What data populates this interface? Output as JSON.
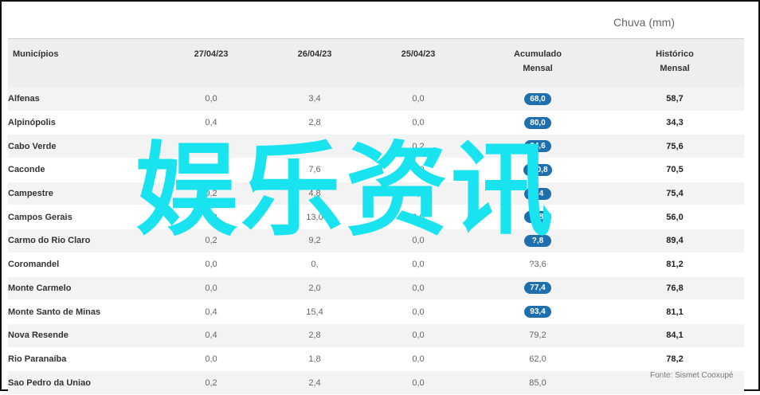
{
  "header": {
    "unit_label": "Chuva (mm)"
  },
  "columns": [
    "Municípios",
    "27/04/23",
    "26/04/23",
    "25/04/23",
    "Acumulado\nMensal",
    "Histórico\nMensal"
  ],
  "rows": [
    {
      "municipio": "Alfenas",
      "d27": "0,0",
      "d26": "3,4",
      "d25": "0,0",
      "acumulado": "68,0",
      "highlight": true,
      "historico": "58,7"
    },
    {
      "municipio": "Alpinópolis",
      "d27": "0,4",
      "d26": "2,8",
      "d25": "0,0",
      "acumulado": "80,0",
      "highlight": true,
      "historico": "34,3"
    },
    {
      "municipio": "Cabo Verde",
      "d27": "0,2",
      "d26": "11,4",
      "d25": "0,2",
      "acumulado": "94,6",
      "highlight": true,
      "historico": "75,6"
    },
    {
      "municipio": "Caconde",
      "d27": "0,2",
      "d26": "7,6",
      "d25": "0,0",
      "acumulado": "140,8",
      "highlight": true,
      "historico": "70,5"
    },
    {
      "municipio": "Campestre",
      "d27": "0,2",
      "d26": "4,8",
      "d25": "0,0",
      "acumulado": "?,4",
      "highlight": true,
      "historico": "75,4"
    },
    {
      "municipio": "Campos Gerais",
      "d27": "0,0",
      "d26": "13,0",
      "d25": "0,0",
      "acumulado": "?,8",
      "highlight": true,
      "historico": "56,0"
    },
    {
      "municipio": "Carmo do Rio Claro",
      "d27": "0,2",
      "d26": "9,2",
      "d25": "0,0",
      "acumulado": "?,8",
      "highlight": true,
      "historico": "89,4"
    },
    {
      "municipio": "Coromandel",
      "d27": "0,0",
      "d26": "0,",
      "d25": "0,0",
      "acumulado": "?3,6",
      "highlight": false,
      "historico": "81,2"
    },
    {
      "municipio": "Monte Carmelo",
      "d27": "0,0",
      "d26": "2,0",
      "d25": "0,0",
      "acumulado": "77,4",
      "highlight": true,
      "historico": "76,8"
    },
    {
      "municipio": "Monte Santo de Minas",
      "d27": "0,4",
      "d26": "15,4",
      "d25": "0,0",
      "acumulado": "93,4",
      "highlight": true,
      "historico": "81,1"
    },
    {
      "municipio": "Nova Resende",
      "d27": "0,4",
      "d26": "2,8",
      "d25": "0,0",
      "acumulado": "79,2",
      "highlight": false,
      "historico": "84,1"
    },
    {
      "municipio": "Rio Paranaíba",
      "d27": "0,0",
      "d26": "1,8",
      "d25": "0,0",
      "acumulado": "62,0",
      "highlight": false,
      "historico": "78,2"
    },
    {
      "municipio": "Sao Pedro da Uniao",
      "d27": "0,2",
      "d26": "2,4",
      "d25": "0,0",
      "acumulado": "85,0",
      "highlight": false,
      "historico": ""
    }
  ],
  "footer": {
    "source": "Fonte: Sismet Cooxupé"
  },
  "overlay": {
    "text": "娱乐资讯",
    "color": "#19e3ee"
  },
  "colors": {
    "pill": "#1f6fae",
    "header_bg": "#eeeeee",
    "stripe": "#f3f3f3"
  }
}
